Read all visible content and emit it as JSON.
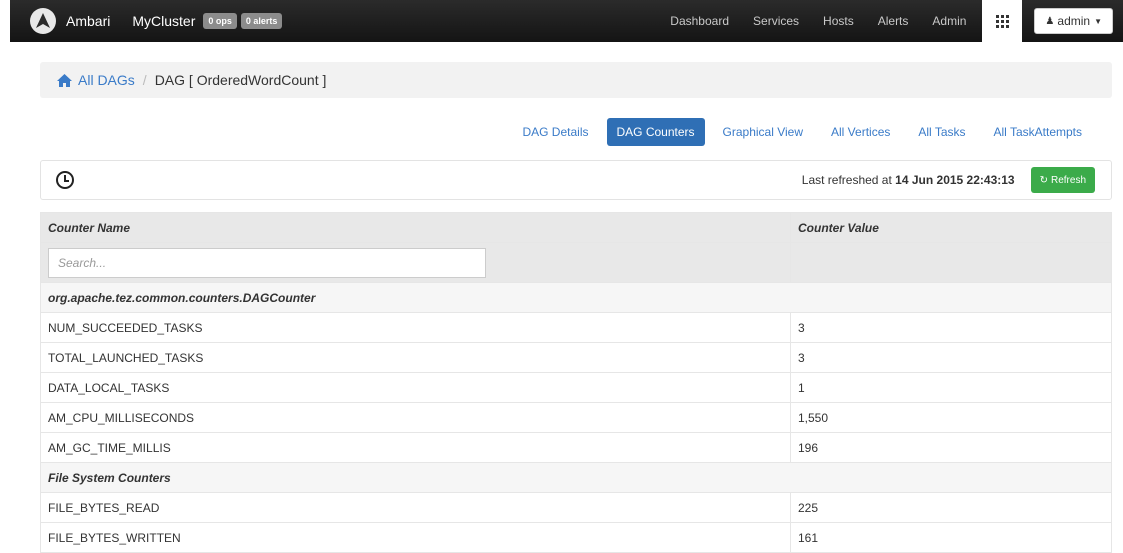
{
  "navbar": {
    "brand": "Ambari",
    "cluster": "MyCluster",
    "ops_badge": "0 ops",
    "alerts_badge": "0 alerts",
    "links": [
      "Dashboard",
      "Services",
      "Hosts",
      "Alerts",
      "Admin"
    ],
    "user": "admin",
    "user_icon": "user-icon",
    "apps_icon": "grid-icon"
  },
  "breadcrumb": {
    "home_icon": "home-icon",
    "root": "All DAGs",
    "separator": "/",
    "current": "DAG [ OrderedWordCount ]"
  },
  "tabs": [
    {
      "label": "DAG Details",
      "active": false
    },
    {
      "label": "DAG Counters",
      "active": true
    },
    {
      "label": "Graphical View",
      "active": false
    },
    {
      "label": "All Vertices",
      "active": false
    },
    {
      "label": "All Tasks",
      "active": false
    },
    {
      "label": "All TaskAttempts",
      "active": false
    }
  ],
  "refresh": {
    "clock_icon": "clock-icon",
    "label": "Last refreshed at",
    "timestamp": "14 Jun 2015 22:43:13",
    "button": "Refresh",
    "button_color": "#3bab4a"
  },
  "table": {
    "headers": [
      "Counter Name",
      "Counter Value"
    ],
    "search_placeholder": "Search...",
    "groups": [
      {
        "name": "org.apache.tez.common.counters.DAGCounter",
        "rows": [
          {
            "name": "NUM_SUCCEEDED_TASKS",
            "value": "3"
          },
          {
            "name": "TOTAL_LAUNCHED_TASKS",
            "value": "3"
          },
          {
            "name": "DATA_LOCAL_TASKS",
            "value": "1"
          },
          {
            "name": "AM_CPU_MILLISECONDS",
            "value": "1,550"
          },
          {
            "name": "AM_GC_TIME_MILLIS",
            "value": "196"
          }
        ]
      },
      {
        "name": "File System Counters",
        "rows": [
          {
            "name": "FILE_BYTES_READ",
            "value": "225"
          },
          {
            "name": "FILE_BYTES_WRITTEN",
            "value": "161"
          }
        ]
      }
    ]
  },
  "colors": {
    "navbar_bg": "#1e1e1e",
    "link": "#3a7bc8",
    "active_tab": "#2f6fb5"
  }
}
